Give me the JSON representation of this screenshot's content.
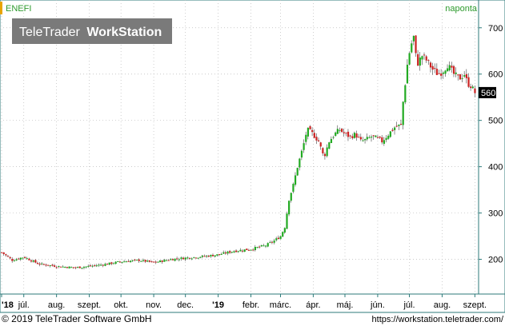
{
  "chart_data": {
    "type": "candlestick",
    "title": "ENEFI",
    "interval": "naponta",
    "watermark": "TeleTrader WorkStation",
    "watermark_parts": [
      "TeleTrader",
      "WorkStation"
    ],
    "last_price_label": "560",
    "ylim": [
      125,
      760
    ],
    "yticks": [
      200,
      300,
      400,
      500,
      600,
      700
    ],
    "x_tick_labels": [
      "'18",
      "júl.",
      "aug.",
      "szept.",
      "okt.",
      "nov.",
      "dec.",
      "'19",
      "febr.",
      "márc.",
      "ápr.",
      "máj.",
      "jún.",
      "júl.",
      "aug.",
      "szept."
    ],
    "x_tick_days": [
      0,
      21,
      52,
      83,
      113,
      144,
      174,
      205,
      236,
      264,
      295,
      325,
      356,
      386,
      417,
      448
    ],
    "grid": true,
    "colors": {
      "up": "#22aa22",
      "down": "#cc2222",
      "grid": "#bbbbbb",
      "axis": "#2c7a7a",
      "title": "#2c9a2c"
    },
    "series": [
      {
        "name": "ENEFI",
        "points": [
          {
            "day": 0,
            "close": 215
          },
          {
            "day": 10,
            "close": 198
          },
          {
            "day": 21,
            "close": 205
          },
          {
            "day": 35,
            "close": 190
          },
          {
            "day": 52,
            "close": 185
          },
          {
            "day": 70,
            "close": 182
          },
          {
            "day": 83,
            "close": 185
          },
          {
            "day": 100,
            "close": 190
          },
          {
            "day": 113,
            "close": 195
          },
          {
            "day": 130,
            "close": 198
          },
          {
            "day": 144,
            "close": 193
          },
          {
            "day": 160,
            "close": 200
          },
          {
            "day": 174,
            "close": 203
          },
          {
            "day": 190,
            "close": 206
          },
          {
            "day": 205,
            "close": 210
          },
          {
            "day": 220,
            "close": 218
          },
          {
            "day": 236,
            "close": 222
          },
          {
            "day": 250,
            "close": 230
          },
          {
            "day": 258,
            "close": 240
          },
          {
            "day": 264,
            "close": 250
          },
          {
            "day": 268,
            "close": 270
          },
          {
            "day": 272,
            "close": 330
          },
          {
            "day": 276,
            "close": 360
          },
          {
            "day": 280,
            "close": 400
          },
          {
            "day": 285,
            "close": 440
          },
          {
            "day": 289,
            "close": 480
          },
          {
            "day": 295,
            "close": 470
          },
          {
            "day": 300,
            "close": 455
          },
          {
            "day": 305,
            "close": 420
          },
          {
            "day": 310,
            "close": 455
          },
          {
            "day": 315,
            "close": 470
          },
          {
            "day": 320,
            "close": 480
          },
          {
            "day": 325,
            "close": 470
          },
          {
            "day": 330,
            "close": 465
          },
          {
            "day": 335,
            "close": 470
          },
          {
            "day": 340,
            "close": 455
          },
          {
            "day": 345,
            "close": 458
          },
          {
            "day": 350,
            "close": 465
          },
          {
            "day": 356,
            "close": 460
          },
          {
            "day": 360,
            "close": 455
          },
          {
            "day": 366,
            "close": 470
          },
          {
            "day": 372,
            "close": 485
          },
          {
            "day": 378,
            "close": 490
          },
          {
            "day": 380,
            "close": 540
          },
          {
            "day": 384,
            "close": 620
          },
          {
            "day": 387,
            "close": 660
          },
          {
            "day": 390,
            "close": 680
          },
          {
            "day": 393,
            "close": 620
          },
          {
            "day": 398,
            "close": 640
          },
          {
            "day": 402,
            "close": 630
          },
          {
            "day": 408,
            "close": 610
          },
          {
            "day": 413,
            "close": 600
          },
          {
            "day": 417,
            "close": 605
          },
          {
            "day": 422,
            "close": 620
          },
          {
            "day": 428,
            "close": 600
          },
          {
            "day": 433,
            "close": 590
          },
          {
            "day": 438,
            "close": 600
          },
          {
            "day": 441,
            "close": 580
          },
          {
            "day": 444,
            "close": 575
          },
          {
            "day": 448,
            "close": 560
          }
        ]
      }
    ]
  },
  "footer": {
    "copyright": "© 2019 TeleTrader Software GmbH",
    "url": "https://workstation.teletrader.com/"
  }
}
